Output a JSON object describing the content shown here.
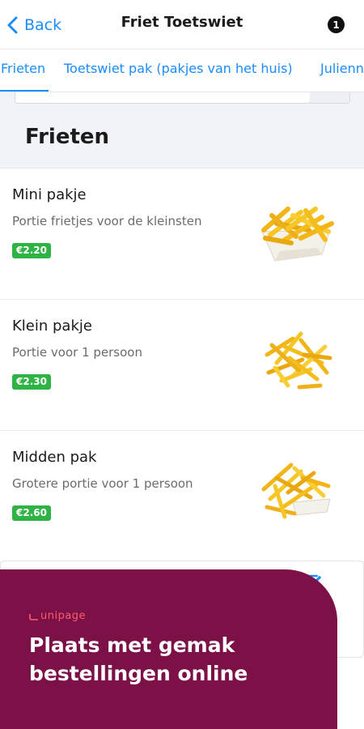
{
  "header": {
    "back_label": "Back",
    "title": "Friet Toetswiet",
    "cart_count": "1"
  },
  "tabs": [
    {
      "label": "Frieten",
      "active": true
    },
    {
      "label": "Toetswiet pak (pakjes van het huis)",
      "active": false
    },
    {
      "label": "Julienne",
      "active": false
    }
  ],
  "section": {
    "title": "Frieten"
  },
  "products": [
    {
      "name": "Mini pakje",
      "description": "Portie frietjes voor de kleinsten",
      "price": "€2.20"
    },
    {
      "name": "Klein pakje",
      "description": "Portie voor 1 persoon",
      "price": "€2.30"
    },
    {
      "name": "Midden pak",
      "description": "Grotere portie voor 1 persoon",
      "price": "€2.60"
    }
  ],
  "promo": {
    "brand": "unipage",
    "headline": "Plaats met gemak bestellingen online"
  },
  "colors": {
    "accent": "#1a8cff",
    "price_badge": "#2fb344",
    "promo_bg": "#7c1148",
    "promo_brand": "#ff5a6e"
  },
  "icons": {
    "back": "chevron-left-icon",
    "edit": "edit-icon",
    "food": "fries-image"
  }
}
